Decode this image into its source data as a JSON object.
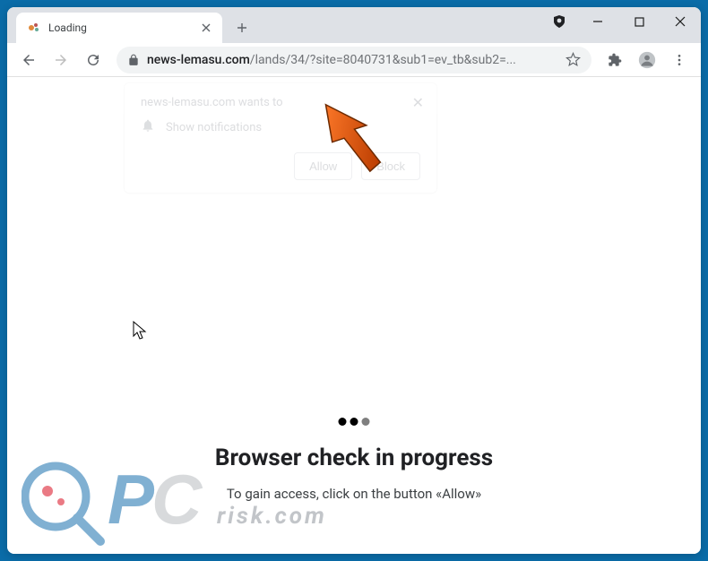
{
  "tab": {
    "title": "Loading"
  },
  "url": {
    "host": "news-lemasu.com",
    "path": "/lands/34/?site=8040731&sub1=ev_tb&sub2=..."
  },
  "notification": {
    "title": "news-lemasu.com wants to",
    "label": "Show notifications",
    "allow": "Allow",
    "block": "Block"
  },
  "page": {
    "headline": "Browser check in progress",
    "subline": "To gain access, click on the button «Allow»"
  },
  "watermark": {
    "brand_p": "P",
    "brand_c": "C",
    "sub": "risk.com"
  }
}
